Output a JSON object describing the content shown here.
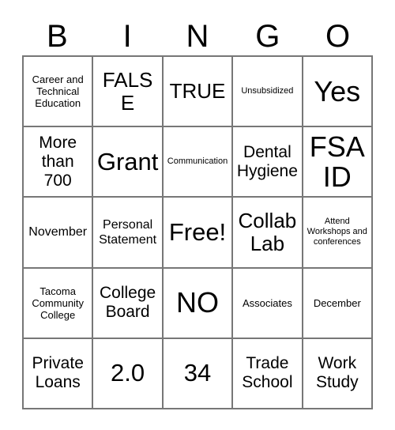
{
  "card": {
    "title": "BINGO",
    "header_letters": [
      "B",
      "I",
      "N",
      "G",
      "O"
    ],
    "rows": [
      [
        {
          "text": "Career and Technical Education",
          "size": "fs-sm"
        },
        {
          "text": "FALSE",
          "size": "fs-xl"
        },
        {
          "text": "TRUE",
          "size": "fs-xl"
        },
        {
          "text": "Unsubsidized",
          "size": "fs-xs"
        },
        {
          "text": "Yes",
          "size": "fs-huge"
        }
      ],
      [
        {
          "text": "More than 700",
          "size": "fs-lg"
        },
        {
          "text": "Grant",
          "size": "fs-xxl"
        },
        {
          "text": "Communication",
          "size": "fs-xs"
        },
        {
          "text": "Dental Hygiene",
          "size": "fs-lg"
        },
        {
          "text": "FSA ID",
          "size": "fs-huge"
        }
      ],
      [
        {
          "text": "November",
          "size": "fs-md"
        },
        {
          "text": "Personal Statement",
          "size": "fs-md"
        },
        {
          "text": "Free!",
          "size": "fs-xxl"
        },
        {
          "text": "Collab Lab",
          "size": "fs-xl"
        },
        {
          "text": "Attend Workshops and conferences",
          "size": "fs-xs"
        }
      ],
      [
        {
          "text": "Tacoma Community College",
          "size": "fs-sm"
        },
        {
          "text": "College Board",
          "size": "fs-lg"
        },
        {
          "text": "NO",
          "size": "fs-huge"
        },
        {
          "text": "Associates",
          "size": "fs-sm"
        },
        {
          "text": "December",
          "size": "fs-sm"
        }
      ],
      [
        {
          "text": "Private Loans",
          "size": "fs-lg"
        },
        {
          "text": "2.0",
          "size": "fs-xxl"
        },
        {
          "text": "34",
          "size": "fs-xxl"
        },
        {
          "text": "Trade School",
          "size": "fs-lg"
        },
        {
          "text": "Work Study",
          "size": "fs-lg"
        }
      ]
    ],
    "free_space": "Free!",
    "colors": {
      "border": "#777777",
      "text": "#000000",
      "background": "#ffffff"
    }
  }
}
